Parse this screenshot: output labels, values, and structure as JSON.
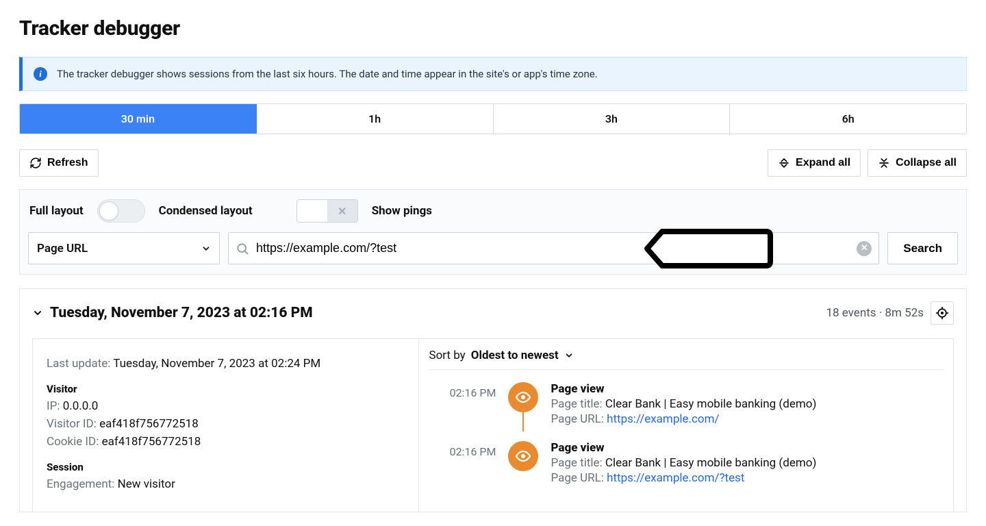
{
  "page_title": "Tracker debugger",
  "info_banner": "The tracker debugger shows sessions from the last six hours. The date and time appear in the site's or app's time zone.",
  "time_tabs": [
    "30 min",
    "1h",
    "3h",
    "6h"
  ],
  "time_tab_active": 0,
  "toolbar": {
    "refresh": "Refresh",
    "expand_all": "Expand all",
    "collapse_all": "Collapse all"
  },
  "filter": {
    "full_layout_label": "Full layout",
    "condensed_layout_label": "Condensed layout",
    "show_pings_label": "Show pings",
    "field_select": "Page URL",
    "search_value": "https://example.com/?test",
    "search_button": "Search"
  },
  "session": {
    "title": "Tuesday, November 7, 2023 at 02:16 PM",
    "meta": "18 events · 8m 52s",
    "last_update_label": "Last update:",
    "last_update_value": "Tuesday, November 7, 2023 at 02:24 PM",
    "visitor_header": "Visitor",
    "ip_label": "IP:",
    "ip_value": "0.0.0.0",
    "visitor_id_label": "Visitor ID:",
    "visitor_id_value": "eaf418f756772518",
    "cookie_id_label": "Cookie ID:",
    "cookie_id_value": "eaf418f756772518",
    "session_header": "Session",
    "engagement_label": "Engagement:",
    "engagement_value": "New visitor",
    "sort_label": "Sort by",
    "sort_value": "Oldest to newest",
    "events": [
      {
        "time": "02:16 PM",
        "title": "Page view",
        "page_title_label": "Page title:",
        "page_title_value": "Clear Bank | Easy mobile banking (demo)",
        "page_url_label": "Page URL:",
        "page_url_value": "https://example.com/"
      },
      {
        "time": "02:16 PM",
        "title": "Page view",
        "page_title_label": "Page title:",
        "page_title_value": "Clear Bank | Easy mobile banking (demo)",
        "page_url_label": "Page URL:",
        "page_url_value": "https://example.com/?test"
      }
    ]
  }
}
